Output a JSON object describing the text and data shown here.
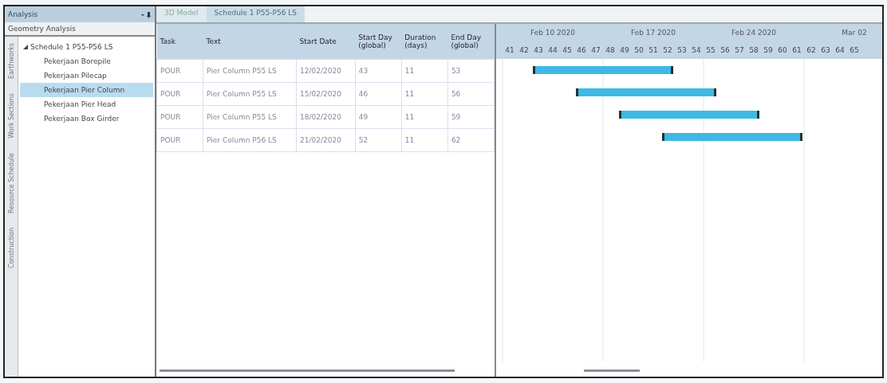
{
  "side_panel": {
    "title": "Analysis",
    "section": "Geometry Analysis",
    "vertical_tabs": [
      "Construction",
      "Resource Schedule",
      "Work Sections",
      "Earthworks"
    ],
    "tree": [
      {
        "label": "Schedule 1 P55-P56 LS",
        "expanded": true,
        "selected": false,
        "children": [
          {
            "label": "Pekerjaan Borepile",
            "selected": false
          },
          {
            "label": "Pekerjaan Pilecap",
            "selected": false
          },
          {
            "label": "Pekerjaan Pier Column",
            "selected": true
          },
          {
            "label": "Pekerjaan Pier Head",
            "selected": false
          },
          {
            "label": "Pekerjaan Box Girder",
            "selected": false
          }
        ]
      }
    ]
  },
  "tabs": [
    {
      "label": "3D Model",
      "selected": false
    },
    {
      "label": "Schedule 1 P55-P56 LS",
      "selected": true
    }
  ],
  "table": {
    "columns": [
      "Task",
      "Text",
      "Start Date",
      "Start Day (global)",
      "Duration (days)",
      "End Day (global)"
    ],
    "rows": [
      [
        "POUR",
        "Pier Column P55 LS",
        "12/02/2020",
        "43",
        "11",
        "53"
      ],
      [
        "POUR",
        "Pier Column P55 LS",
        "15/02/2020",
        "46",
        "11",
        "56"
      ],
      [
        "POUR",
        "Pier Column P55 LS",
        "18/02/2020",
        "49",
        "11",
        "59"
      ],
      [
        "POUR",
        "Pier Column P56 LS",
        "21/02/2020",
        "52",
        "11",
        "62"
      ]
    ]
  },
  "gantt": {
    "weeks": [
      "Feb 10 2020",
      "Feb 17 2020",
      "Feb 24 2020",
      "Mar 02"
    ],
    "days": [
      "41",
      "42",
      "43",
      "44",
      "45",
      "46",
      "47",
      "48",
      "49",
      "50",
      "51",
      "52",
      "53",
      "54",
      "55",
      "56",
      "57",
      "58",
      "59",
      "60",
      "61",
      "62",
      "63",
      "64",
      "65"
    ]
  }
}
